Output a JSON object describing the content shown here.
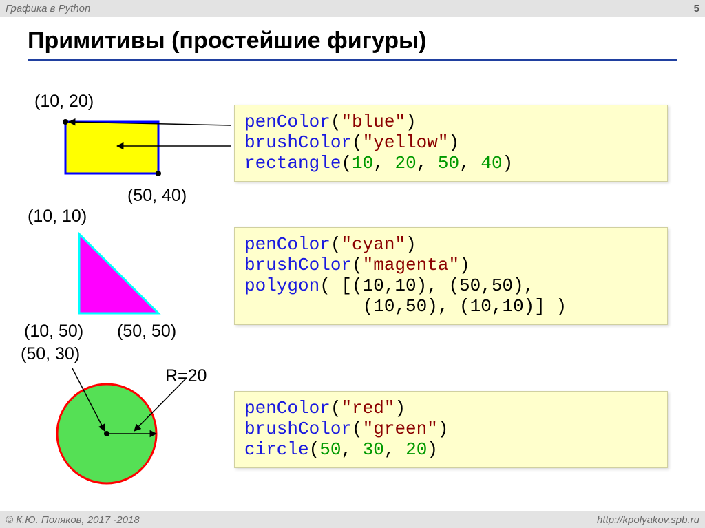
{
  "header": {
    "left": "Графика в Python",
    "page": "5"
  },
  "footer": {
    "left": "© К.Ю. Поляков, 2017 -2018",
    "right": "http://kpolyakov.spb.ru"
  },
  "title": "Примитивы (простейшие фигуры)",
  "labels": {
    "rect_p1": "(10, 20)",
    "rect_p2": "(50, 40)",
    "tri_p1": "(10, 10)",
    "tri_p2": "(10, 50)",
    "tri_p3": "(50, 50)",
    "circ_c": "(50, 30)",
    "circ_r": "R=20"
  },
  "code": {
    "rect": {
      "l1_fn": "penColor",
      "l1_open": "(",
      "l1_str": "\"blue\"",
      "l1_close": ")",
      "l2_fn": "brushColor",
      "l2_open": "(",
      "l2_str": "\"yellow\"",
      "l2_close": ")",
      "l3_fn": "rectangle",
      "l3_open": "(",
      "l3_n1": "10",
      "l3_c1": ", ",
      "l3_n2": "20",
      "l3_c2": ", ",
      "l3_n3": "50",
      "l3_c3": ", ",
      "l3_n4": "40",
      "l3_close": ")"
    },
    "poly": {
      "l1_fn": "penColor",
      "l1_open": "(",
      "l1_str": "\"cyan\"",
      "l1_close": ")",
      "l2_fn": "brushColor",
      "l2_open": "(",
      "l2_str": "\"magenta\"",
      "l2_close": ")",
      "l3_fn": "polygon",
      "l3_text": "( [(10,10), (50,50),",
      "l4_text": "           (10,50), (10,10)] )"
    },
    "circ": {
      "l1_fn": "penColor",
      "l1_open": "(",
      "l1_str": "\"red\"",
      "l1_close": ")",
      "l2_fn": "brushColor",
      "l2_open": "(",
      "l2_str": "\"green\"",
      "l2_close": ")",
      "l3_fn": "circle",
      "l3_open": "(",
      "l3_n1": "50",
      "l3_c1": ", ",
      "l3_n2": "30",
      "l3_c2": ", ",
      "l3_n3": "20",
      "l3_close": ")"
    }
  }
}
